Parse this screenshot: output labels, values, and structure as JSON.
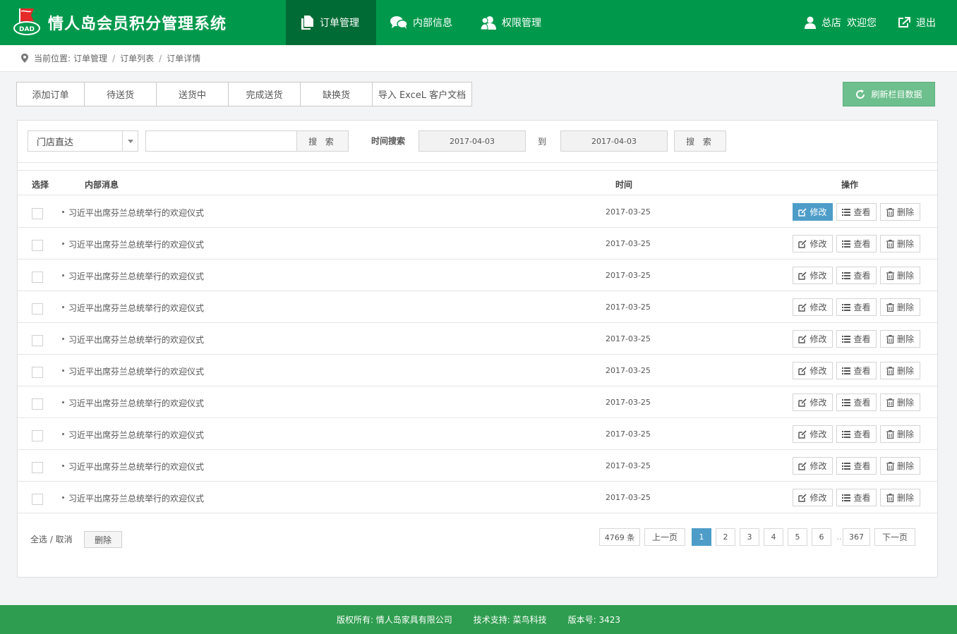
{
  "header": {
    "title": "情人岛会员积分管理系统",
    "logo_text": "DAD",
    "nav": [
      {
        "label": "订单管理",
        "active": true
      },
      {
        "label": "内部信息",
        "active": false
      },
      {
        "label": "权限管理",
        "active": false
      }
    ],
    "user_store": "总店",
    "welcome": "欢迎您",
    "logout": "退出"
  },
  "breadcrumb": {
    "prefix": "当前位置:",
    "items": [
      "订单管理",
      "订单列表",
      "订单详情"
    ],
    "separator": "/"
  },
  "toolbar": {
    "tabs": [
      "添加订单",
      "待送货",
      "送货中",
      "完成送货",
      "缺换货",
      "导入 ExceL 客户文档"
    ],
    "refresh_label": "刷新栏目数据"
  },
  "filter": {
    "store_select_value": "门店直达",
    "keyword_value": "",
    "search_label": "搜 索",
    "time_search_label": "时间搜索",
    "date_from": "2017-04-03",
    "to_label": "到",
    "date_to": "2017-04-03",
    "search2_label": "搜 索"
  },
  "table": {
    "headers": {
      "select": "选择",
      "message": "内部消息",
      "time": "时间",
      "ops": "操作"
    },
    "ops": {
      "edit": "修改",
      "view": "查看",
      "delete": "删除"
    },
    "rows": [
      {
        "message": "习近平出席芬兰总统举行的欢迎仪式",
        "time": "2017-03-25"
      },
      {
        "message": "习近平出席芬兰总统举行的欢迎仪式",
        "time": "2017-03-25"
      },
      {
        "message": "习近平出席芬兰总统举行的欢迎仪式",
        "time": "2017-03-25"
      },
      {
        "message": "习近平出席芬兰总统举行的欢迎仪式",
        "time": "2017-03-25"
      },
      {
        "message": "习近平出席芬兰总统举行的欢迎仪式",
        "time": "2017-03-25"
      },
      {
        "message": "习近平出席芬兰总统举行的欢迎仪式",
        "time": "2017-03-25"
      },
      {
        "message": "习近平出席芬兰总统举行的欢迎仪式",
        "time": "2017-03-25"
      },
      {
        "message": "习近平出席芬兰总统举行的欢迎仪式",
        "time": "2017-03-25"
      },
      {
        "message": "习近平出席芬兰总统举行的欢迎仪式",
        "time": "2017-03-25"
      },
      {
        "message": "习近平出席芬兰总统举行的欢迎仪式",
        "time": "2017-03-25"
      }
    ]
  },
  "bulk": {
    "select_all": "全选 / 取消",
    "delete": "删除"
  },
  "pager": {
    "total": "4769 条",
    "prev": "上一页",
    "pages": [
      "1",
      "2",
      "3",
      "4",
      "5",
      "6"
    ],
    "current": "1",
    "dots": "..",
    "last": "367",
    "next": "下一页"
  },
  "footer": {
    "copyright": "版权所有: 情人岛家具有限公司",
    "support": "技术支持: 菜鸟科技",
    "version": "版本号: 3423"
  },
  "colors": {
    "header_bg": "#00994c",
    "nav_active": "#006b35",
    "accent_blue": "#4e9dc9",
    "refresh_green": "#6dbf8d",
    "footer_bg": "#2e9d4f"
  }
}
